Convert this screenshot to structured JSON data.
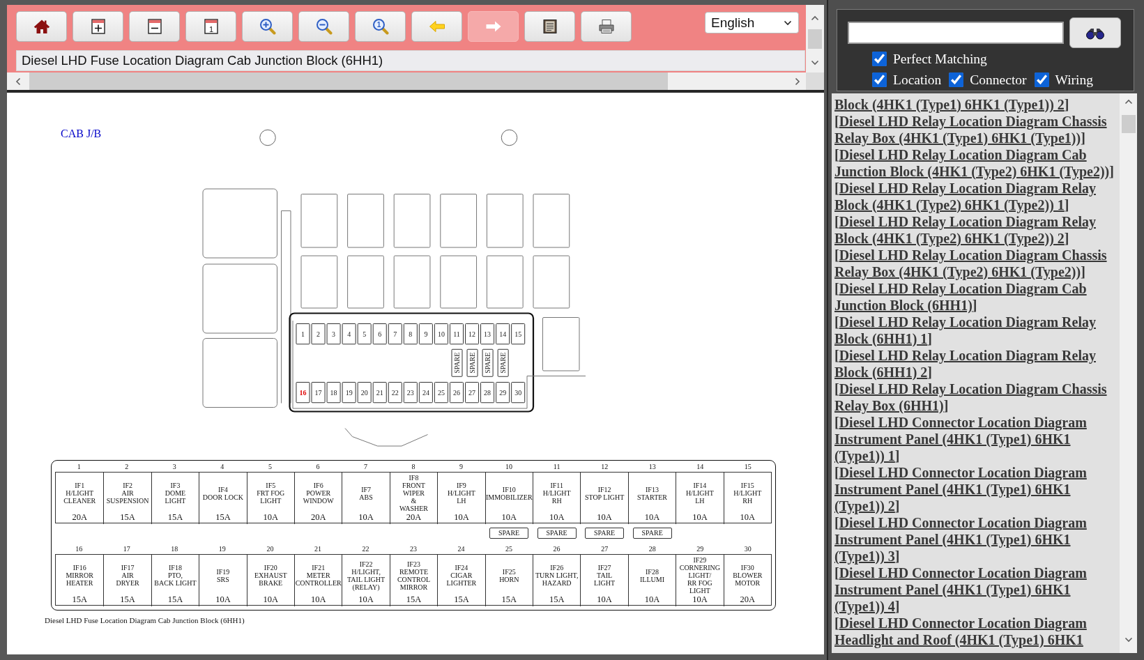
{
  "toolbar": {
    "buttons": [
      {
        "kind": "home",
        "disabled": false
      },
      {
        "kind": "add_page",
        "disabled": false
      },
      {
        "kind": "remove_page",
        "disabled": false
      },
      {
        "kind": "page_one",
        "glyph": "1",
        "disabled": false
      },
      {
        "kind": "zoom_in",
        "disabled": false
      },
      {
        "kind": "zoom_out",
        "disabled": false
      },
      {
        "kind": "zoom_actual",
        "glyph": "1",
        "disabled": false
      },
      {
        "kind": "back",
        "disabled": false
      },
      {
        "kind": "forward",
        "disabled": true
      },
      {
        "kind": "notes",
        "disabled": false
      },
      {
        "kind": "print",
        "disabled": false
      }
    ],
    "language": "English"
  },
  "title_field": {
    "value": "Diesel LHD Fuse Location Diagram Cab Junction Block (6HH1)"
  },
  "diagram": {
    "label": "CAB J/B",
    "block": {
      "top_fuses": [
        {
          "number": "1",
          "highlighted": false
        },
        {
          "number": "2",
          "highlighted": false
        },
        {
          "number": "3",
          "highlighted": false
        },
        {
          "number": "4",
          "highlighted": false
        },
        {
          "number": "5",
          "highlighted": false
        },
        {
          "number": "6",
          "highlighted": false
        },
        {
          "number": "7",
          "highlighted": false
        },
        {
          "number": "8",
          "highlighted": false
        },
        {
          "number": "9",
          "highlighted": false
        },
        {
          "number": "10",
          "highlighted": false
        },
        {
          "number": "11",
          "highlighted": false
        },
        {
          "number": "12",
          "highlighted": false
        },
        {
          "number": "13",
          "highlighted": false
        },
        {
          "number": "14",
          "highlighted": false
        },
        {
          "number": "15",
          "highlighted": false
        }
      ],
      "spares": [
        {
          "label": "SPARE"
        },
        {
          "label": "SPARE"
        },
        {
          "label": "SPARE"
        },
        {
          "label": "SPARE"
        }
      ],
      "bottom_fuses": [
        {
          "number": "16",
          "highlighted": true
        },
        {
          "number": "17",
          "highlighted": false
        },
        {
          "number": "18",
          "highlighted": false
        },
        {
          "number": "19",
          "highlighted": false
        },
        {
          "number": "20",
          "highlighted": false
        },
        {
          "number": "21",
          "highlighted": false
        },
        {
          "number": "22",
          "highlighted": false
        },
        {
          "number": "23",
          "highlighted": false
        },
        {
          "number": "24",
          "highlighted": false
        },
        {
          "number": "25",
          "highlighted": false
        },
        {
          "number": "26",
          "highlighted": false
        },
        {
          "number": "27",
          "highlighted": false
        },
        {
          "number": "28",
          "highlighted": false
        },
        {
          "number": "29",
          "highlighted": false
        },
        {
          "number": "30",
          "highlighted": false
        }
      ]
    },
    "table": {
      "top": [
        {
          "number": "1",
          "label": "IF1\nH/LIGHT\nCLEANER",
          "rating": "20A"
        },
        {
          "number": "2",
          "label": "IF2\nAIR\nSUSPENSION",
          "rating": "15A"
        },
        {
          "number": "3",
          "label": "IF3\nDOME\nLIGHT",
          "rating": "15A"
        },
        {
          "number": "4",
          "label": "IF4\nDOOR LOCK",
          "rating": "15A"
        },
        {
          "number": "5",
          "label": "IF5\nFRT FOG\nLIGHT",
          "rating": "10A"
        },
        {
          "number": "6",
          "label": "IF6\nPOWER\nWINDOW",
          "rating": "20A"
        },
        {
          "number": "7",
          "label": "IF7\nABS",
          "rating": "10A"
        },
        {
          "number": "8",
          "label": "IF8\nFRONT\nWIPER\n&\nWASHER",
          "rating": "20A"
        },
        {
          "number": "9",
          "label": "IF9\nH/LIGHT\nLH",
          "rating": "10A"
        },
        {
          "number": "10",
          "label": "IF10\nIMMOBILIZER",
          "rating": "10A"
        },
        {
          "number": "11",
          "label": "IF11\nH/LIGHT\nRH",
          "rating": "10A"
        },
        {
          "number": "12",
          "label": "IF12\nSTOP LIGHT",
          "rating": "10A"
        },
        {
          "number": "13",
          "label": "IF13\nSTARTER",
          "rating": "10A"
        },
        {
          "number": "14",
          "label": "IF14\nH/LIGHT\nLH",
          "rating": "10A"
        },
        {
          "number": "15",
          "label": "IF15\nH/LIGHT\nRH",
          "rating": "10A"
        }
      ],
      "spares": [
        {
          "label": "SPARE"
        },
        {
          "label": "SPARE"
        },
        {
          "label": "SPARE"
        },
        {
          "label": "SPARE"
        }
      ],
      "bottom": [
        {
          "number": "16",
          "label": "IF16\nMIRROR\nHEATER",
          "rating": "15A"
        },
        {
          "number": "17",
          "label": "IF17\nAIR\nDRYER",
          "rating": "15A"
        },
        {
          "number": "18",
          "label": "IF18\nPTO,\nBACK LIGHT",
          "rating": "15A"
        },
        {
          "number": "19",
          "label": "IF19\nSRS",
          "rating": "10A"
        },
        {
          "number": "20",
          "label": "IF20\nEXHAUST\nBRAKE",
          "rating": "10A"
        },
        {
          "number": "21",
          "label": "IF21\nMETER\nCONTROLLER",
          "rating": "10A"
        },
        {
          "number": "22",
          "label": "IF22\nH/LIGHT,\nTAIL LIGHT\n(RELAY)",
          "rating": "10A"
        },
        {
          "number": "23",
          "label": "IF23\nREMOTE\nCONTROL\nMIRROR",
          "rating": "15A"
        },
        {
          "number": "24",
          "label": "IF24\nCIGAR\nLIGHTER",
          "rating": "15A"
        },
        {
          "number": "25",
          "label": "IF25\nHORN",
          "rating": "15A"
        },
        {
          "number": "26",
          "label": "IF26\nTURN LIGHT,\nHAZARD",
          "rating": "15A"
        },
        {
          "number": "27",
          "label": "IF27\nTAIL\nLIGHT",
          "rating": "10A"
        },
        {
          "number": "28",
          "label": "IF28\nILLUMI",
          "rating": "10A"
        },
        {
          "number": "29",
          "label": "IF29\nCORNERING\nLIGHT/\nRR FOG\nLIGHT",
          "rating": "10A"
        },
        {
          "number": "30",
          "label": "IF30\nBLOWER\nMOTOR",
          "rating": "20A"
        }
      ]
    },
    "caption": "Diesel LHD Fuse Location Diagram Cab Junction Block (6HH1)"
  },
  "search": {
    "filter_rows": [
      [
        {
          "label": "Perfect Matching",
          "checked": true
        }
      ],
      [
        {
          "label": "Location",
          "checked": true
        },
        {
          "label": "Connector",
          "checked": true
        },
        {
          "label": "Wiring",
          "checked": true
        }
      ]
    ]
  },
  "results": [
    {
      "link": "Block (4HK1 (Type1) 6HK1 (Type1)) 2",
      "close": "]"
    },
    {
      "open": "[",
      "link": "Diesel LHD Relay Location Diagram Chassis Relay Box (4HK1 (Type1) 6HK1 (Type1))",
      "close": "]"
    },
    {
      "open": "[",
      "link": "Diesel LHD Relay Location Diagram Cab Junction Block (4HK1 (Type2) 6HK1 (Type2))",
      "close": "]"
    },
    {
      "open": "[",
      "link": "Diesel LHD Relay Location Diagram Relay Block (4HK1 (Type2) 6HK1 (Type2)) 1",
      "close": "]"
    },
    {
      "open": "[",
      "link": "Diesel LHD Relay Location Diagram Relay Block (4HK1 (Type2) 6HK1 (Type2)) 2",
      "close": "]"
    },
    {
      "open": "[",
      "link": "Diesel LHD Relay Location Diagram Chassis Relay Box (4HK1 (Type2) 6HK1 (Type2))",
      "close": "]"
    },
    {
      "open": "[",
      "link": "Diesel LHD Relay Location Diagram Cab Junction Block (6HH1)",
      "close": "]"
    },
    {
      "open": "[",
      "link": "Diesel LHD Relay Location Diagram Relay Block (6HH1) 1",
      "close": "]"
    },
    {
      "open": "[",
      "link": "Diesel LHD Relay Location Diagram Relay Block (6HH1) 2",
      "close": "]"
    },
    {
      "open": "[",
      "link": "Diesel LHD Relay Location Diagram Chassis Relay Box (6HH1)",
      "close": "]"
    },
    {
      "open": "[",
      "link": "Diesel LHD Connector Location Diagram Instrument Panel (4HK1 (Type1) 6HK1 (Type1)) 1",
      "close": "]"
    },
    {
      "open": "[",
      "link": "Diesel LHD Connector Location Diagram Instrument Panel (4HK1 (Type1) 6HK1 (Type1)) 2",
      "close": "]"
    },
    {
      "open": "[",
      "link": "Diesel LHD Connector Location Diagram Instrument Panel (4HK1 (Type1) 6HK1 (Type1)) 3",
      "close": "]"
    },
    {
      "open": "[",
      "link": "Diesel LHD Connector Location Diagram Instrument Panel (4HK1 (Type1) 6HK1 (Type1)) 4",
      "close": "]"
    },
    {
      "open": "[",
      "link": "Diesel LHD Connector Location Diagram Headlight and Roof (4HK1 (Type1) 6HK1"
    }
  ]
}
